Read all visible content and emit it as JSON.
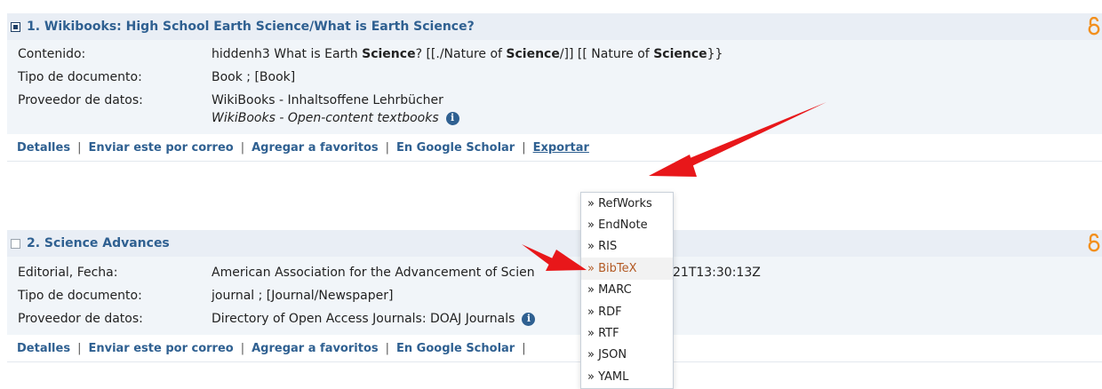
{
  "records": [
    {
      "title": "1. Wikibooks: High School Earth Science/What is Earth Science?",
      "checked": true,
      "fields": {
        "contenido_label": "Contenido:",
        "contenido_parts": [
          "hiddenh3 What is Earth ",
          "Science",
          "? [[./Nature of ",
          "Science",
          "/]] [[ Nature of ",
          "Science",
          "}}"
        ],
        "tipo_label": "Tipo de documento:",
        "tipo_value": "Book ; [Book]",
        "proveedor_label": "Proveedor de datos:",
        "proveedor_value": "WikiBooks - Inhaltsoffene Lehrbücher",
        "proveedor_sub": "WikiBooks - Open-content textbooks"
      }
    },
    {
      "title": "2. Science Advances",
      "checked": false,
      "fields": {
        "editorial_label": "Editorial, Fecha:",
        "editorial_value": "American Association for the Advancement of Scien",
        "editorial_tail": "21T13:30:13Z",
        "tipo_label": "Tipo de documento:",
        "tipo_value": "journal ; [Journal/Newspaper]",
        "proveedor_label": "Proveedor de datos:",
        "proveedor_value": "Directory of Open Access Journals: DOAJ Journals"
      }
    }
  ],
  "actions": {
    "detalles": "Detalles",
    "correo": "Enviar este por correo",
    "favoritos": "Agregar a favoritos",
    "scholar": "En Google Scholar",
    "exportar": "Exportar",
    "separator": "|"
  },
  "export_menu": [
    "» RefWorks",
    "» EndNote",
    "» RIS",
    "» BibTeX",
    "» MARC",
    "» RDF",
    "» RTF",
    "» JSON",
    "» YAML"
  ],
  "export_menu_selected": "» BibTeX",
  "icons": {
    "open_access": "open-access-icon",
    "info": "info-icon",
    "info_glyph": "i"
  },
  "colors": {
    "link": "#2f6091",
    "header_bg": "#e9eef5",
    "body_bg": "#f1f5f9",
    "oa": "#f2901e",
    "arrow": "#e8171a",
    "highlight": "#b35a24"
  }
}
